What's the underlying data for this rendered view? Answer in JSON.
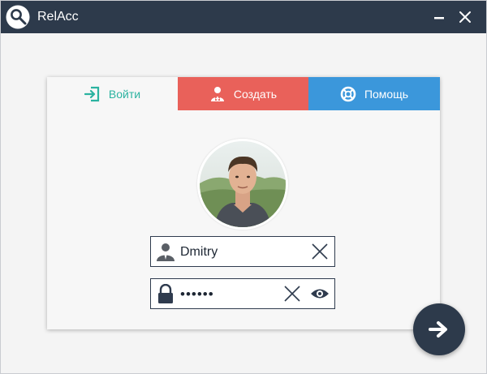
{
  "window": {
    "title": "RelAcc"
  },
  "tabs": [
    {
      "label": "Войти",
      "icon": "sign-in-icon",
      "color": "#2bb3a0"
    },
    {
      "label": "Создать",
      "icon": "add-user-icon",
      "color": "#e9615a"
    },
    {
      "label": "Помощь",
      "icon": "lifebuoy-icon",
      "color": "#3b97db"
    }
  ],
  "login": {
    "username": "Dmitry",
    "password": "••••••"
  },
  "colors": {
    "titlebar": "#2d3a4b",
    "accent_login": "#2bb3a0",
    "accent_create": "#e9615a",
    "accent_help": "#3b97db",
    "field_border": "#2f3b4e"
  }
}
